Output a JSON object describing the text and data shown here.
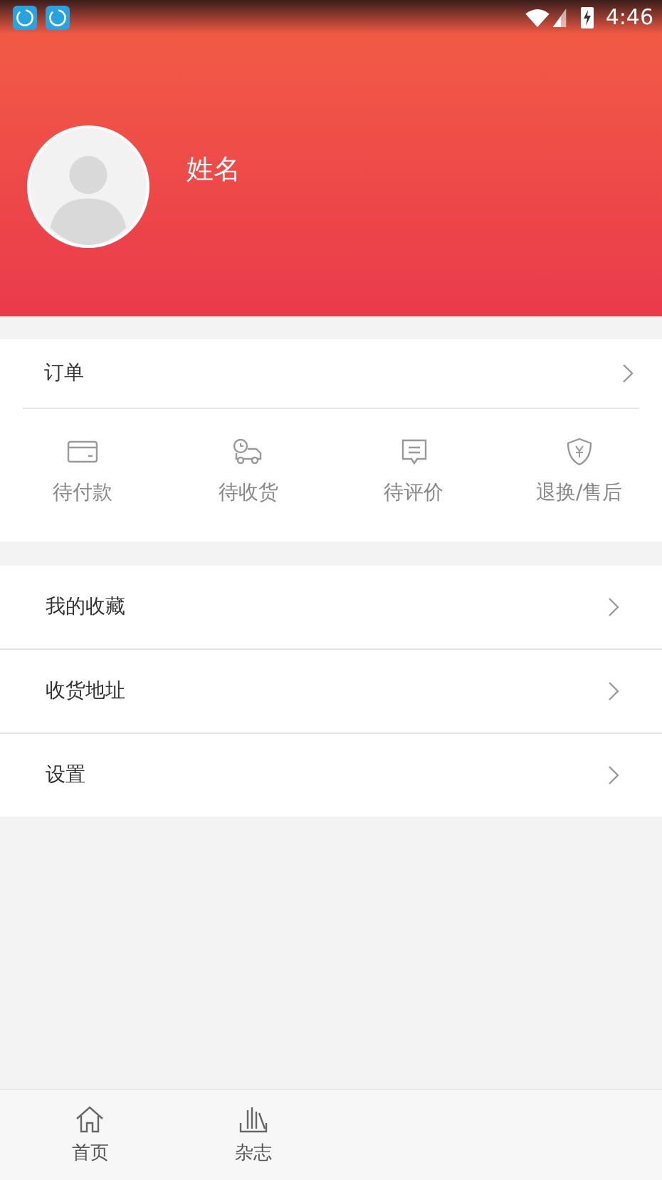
{
  "status_bar": {
    "time": "4:46"
  },
  "profile": {
    "name": "姓名"
  },
  "orders": {
    "title": "订单",
    "statuses": [
      {
        "label": "待付款"
      },
      {
        "label": "待收货"
      },
      {
        "label": "待评价"
      },
      {
        "label": "退换/售后"
      }
    ]
  },
  "menu": [
    {
      "label": "我的收藏"
    },
    {
      "label": "收货地址"
    },
    {
      "label": "设置"
    }
  ],
  "bottom_nav": [
    {
      "label": "首页"
    },
    {
      "label": "杂志"
    }
  ]
}
